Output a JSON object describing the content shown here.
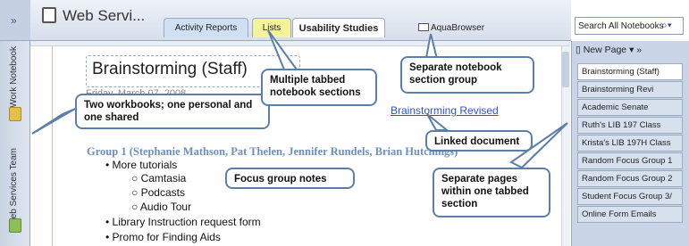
{
  "left_strip": {
    "collapse_label": "»",
    "notebooks": [
      "Work Notebook",
      "Web Services Team"
    ]
  },
  "header": {
    "title": "Web Servi...",
    "tabs": [
      "Activity Reports",
      "Lists",
      "Usability Studies",
      "AquaBrowser"
    ],
    "search_placeholder": "Search All Notebooks"
  },
  "page": {
    "heading": "Brainstorming (Staff)",
    "date_partial": "Friday, March 07, 2008",
    "linked_doc": "Brainstorming Revised",
    "group1": "Group 1 (Stephanie Mathson, Pat Thelen, Jennifer Rundels, Brian Hutchings)",
    "bullets": [
      "More tutorials",
      "Library Instruction request form",
      "Promo for Finding Aids"
    ],
    "sub_bullets": [
      "Camtasia",
      "Podcasts",
      "Audio Tour"
    ]
  },
  "right_pane": {
    "new_page": "New Page",
    "pages": [
      "Brainstorming (Staff)",
      "Brainstorming Revi",
      "Academic Senate",
      "Ruth's LIB 197 Class",
      "Krista's LIB 197H Class",
      "Random Focus Group 1",
      "Random Focus Group 2",
      "Student Focus Group 3/",
      "Online Form Emails"
    ]
  },
  "callouts": {
    "workbooks": "Two workbooks; one personal and one shared",
    "tabbed": "Multiple tabbed notebook sections",
    "separate_group": "Separate notebook section group",
    "linked": "Linked document",
    "focus": "Focus group notes",
    "pages": "Separate pages within one tabbed section"
  },
  "colors": {
    "accent": "#5c7fa8",
    "lists_tab": "#f5f39a",
    "group_text": "#6c8fbf"
  }
}
